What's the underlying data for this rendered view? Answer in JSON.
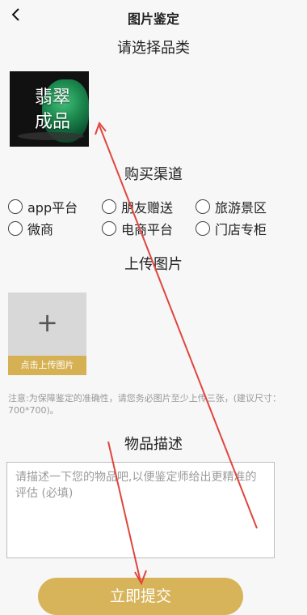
{
  "header": {
    "title": "图片鉴定",
    "back_icon": "back-arrow-icon"
  },
  "category_section": {
    "title": "请选择品类",
    "product_label_line1": "翡翠",
    "product_label_line2": "成品"
  },
  "channel_section": {
    "title": "购买渠道",
    "options_row1": [
      "app平台",
      "朋友赠送",
      "旅游景区"
    ],
    "options_row2": [
      "微商",
      "电商平台",
      "门店专柜"
    ]
  },
  "upload_section": {
    "title": "上传图片",
    "plus": "+",
    "upload_label": "点击上传图片",
    "note": "注意:为保障鉴定的准确性，请您务必图片至少上传三张，(建议尺寸：700*700)。"
  },
  "description_section": {
    "title": "物品描述",
    "placeholder": "请描述一下您的物品吧,以便鉴定师给出更精准的评估 (必填)"
  },
  "submit": {
    "label": "立即提交"
  },
  "colors": {
    "accent": "#d7b45a",
    "upload_label_bg": "#d6b154",
    "annotation_arrow": "#e0453d",
    "page_bg": "#f7f7f7"
  }
}
